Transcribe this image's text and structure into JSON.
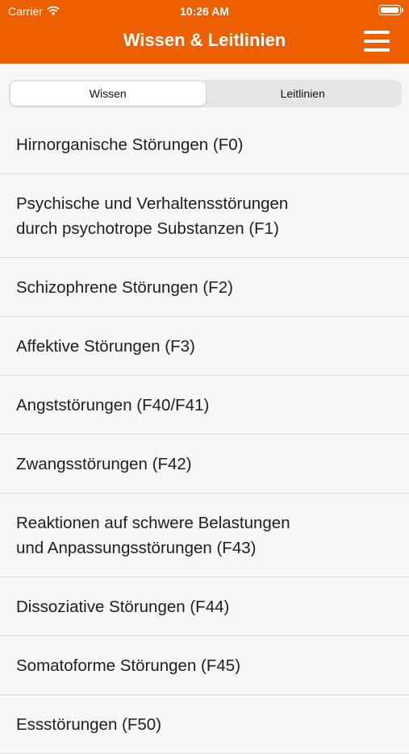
{
  "status_bar": {
    "carrier": "Carrier",
    "time": "10:26 AM"
  },
  "header": {
    "title": "Wissen & Leitlinien"
  },
  "segments": [
    {
      "label": "Wissen",
      "active": true
    },
    {
      "label": "Leitlinien",
      "active": false
    }
  ],
  "items": [
    {
      "label": "Hirnorganische Störungen (F0)"
    },
    {
      "label": "Psychische und Verhaltensstörungen\ndurch psychotrope Substanzen (F1)"
    },
    {
      "label": "Schizophrene Störungen (F2)"
    },
    {
      "label": "Affektive Störungen (F3)"
    },
    {
      "label": "Angststörungen (F40/F41)"
    },
    {
      "label": "Zwangsstörungen (F42)"
    },
    {
      "label": "Reaktionen auf schwere Belastungen\nund Anpassungsstörungen (F43)"
    },
    {
      "label": "Dissoziative Störungen (F44)"
    },
    {
      "label": "Somatoforme Störungen (F45)"
    },
    {
      "label": "Essstörungen (F50)"
    }
  ],
  "colors": {
    "accent": "#ee5f00",
    "background": "#f7f7f7"
  }
}
